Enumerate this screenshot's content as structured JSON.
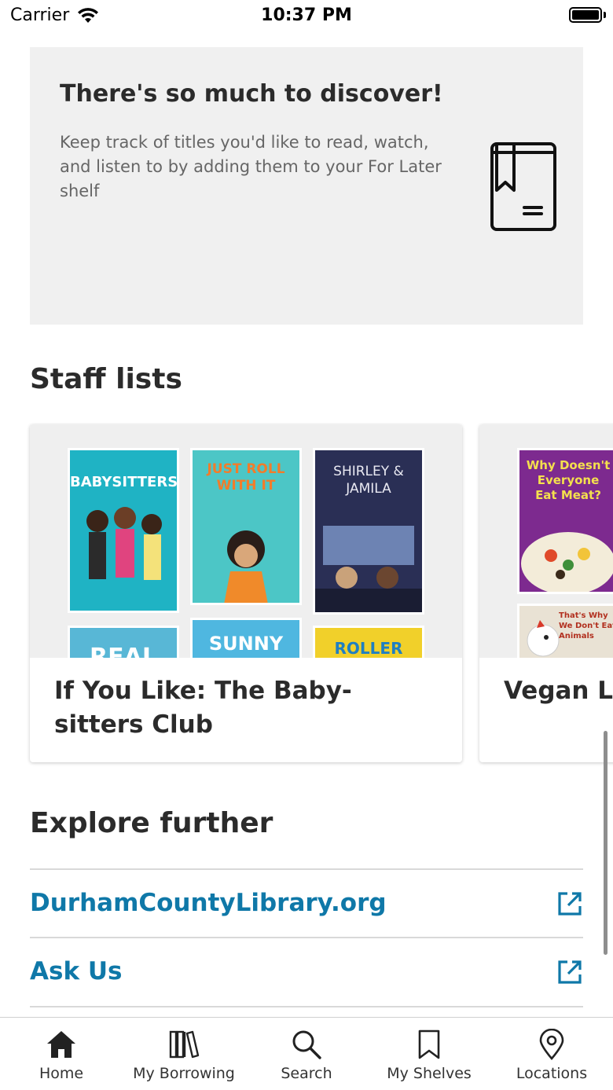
{
  "status_bar": {
    "carrier": "Carrier",
    "time": "10:37 PM"
  },
  "promo": {
    "title": "There's so much to discover!",
    "text": "Keep track of titles you'd like to read, watch, and listen to by adding them to your For Later shelf",
    "icon": "book-icon"
  },
  "staff_lists": {
    "heading": "Staff lists",
    "cards": [
      {
        "title": "If You Like: The Baby-sitters Club",
        "covers": [
          {
            "text": "BABYSITTERS",
            "color": "#1fb3c4"
          },
          {
            "text": "JUST ROLL WITH IT",
            "color": "#4cc6c6"
          },
          {
            "text": "SHIRLEY & JAMILA",
            "color": "#2a2f55"
          },
          {
            "text": "REAL",
            "color": "#58b7d6"
          },
          {
            "text": "SUNNY",
            "color": "#4fb7e0"
          },
          {
            "text": "ROLLER GIRL",
            "color": "#f1d02a"
          }
        ]
      },
      {
        "title": "Vegan Living",
        "covers": [
          {
            "text": "Why Doesn't Everyone Eat Meat?",
            "color": "#7d2a8f"
          },
          {
            "text": "That's Why We Don't Eat Animals",
            "color": "#e9e2d4"
          }
        ]
      }
    ]
  },
  "explore": {
    "heading": "Explore further",
    "links": [
      {
        "label": "DurhamCountyLibrary.org",
        "icon": "external-link-icon"
      },
      {
        "label": "Ask Us",
        "icon": "external-link-icon"
      }
    ]
  },
  "tabs": [
    {
      "label": "Home",
      "icon": "home-icon",
      "active": true
    },
    {
      "label": "My Borrowing",
      "icon": "books-icon",
      "active": false
    },
    {
      "label": "Search",
      "icon": "search-icon",
      "active": false
    },
    {
      "label": "My Shelves",
      "icon": "bookmark-icon",
      "active": false
    },
    {
      "label": "Locations",
      "icon": "location-pin-icon",
      "active": false
    }
  ],
  "colors": {
    "link": "#0f78a8",
    "promo_background": "#f0f0f0",
    "text": "#2b2b2b"
  }
}
